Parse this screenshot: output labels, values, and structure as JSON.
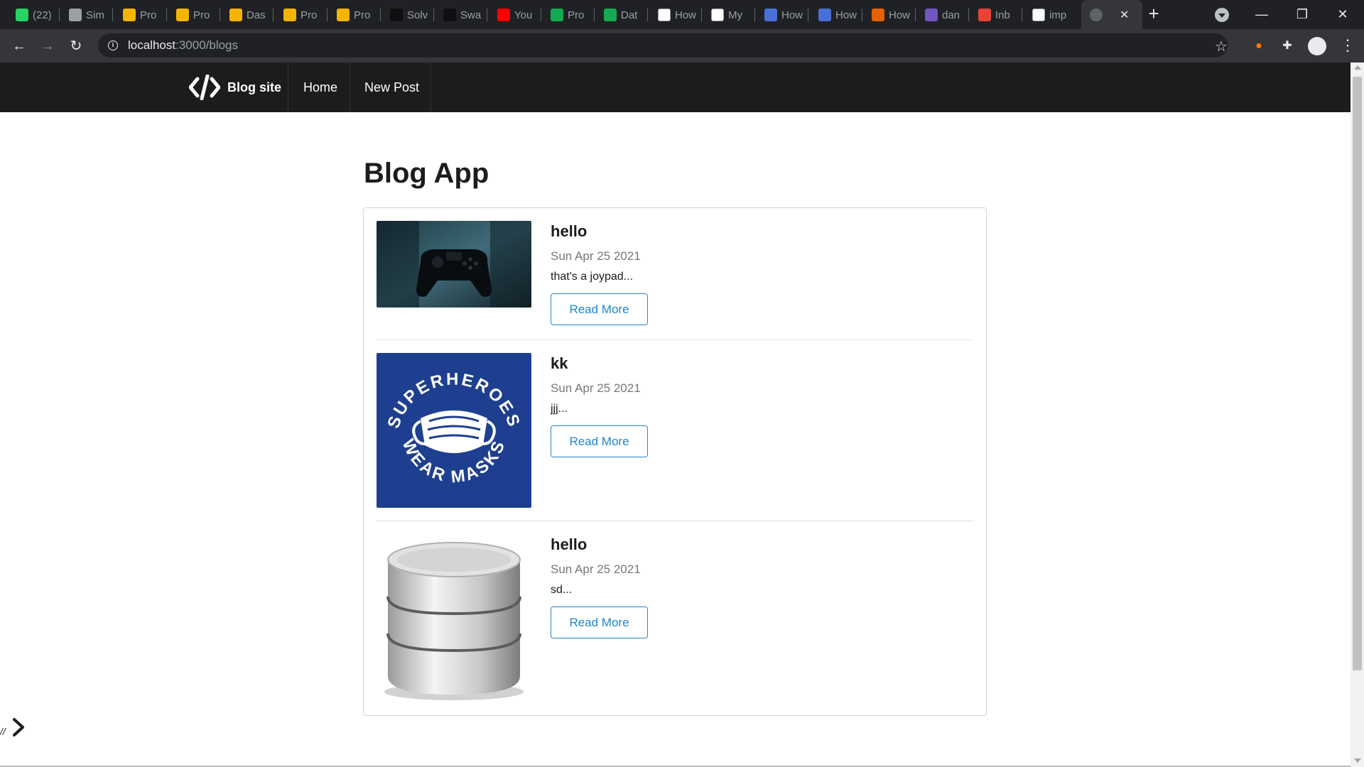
{
  "browser": {
    "tabs": [
      {
        "label": "(22)",
        "favicon": "whatsapp-icon",
        "color": "#25d366"
      },
      {
        "label": "Sim",
        "favicon": "runner-icon",
        "color": "#9aa0a6"
      },
      {
        "label": "Pro",
        "favicon": "chart-icon",
        "color": "#f4b400"
      },
      {
        "label": "Pro",
        "favicon": "chart-icon",
        "color": "#f4b400"
      },
      {
        "label": "Das",
        "favicon": "chart-icon",
        "color": "#f4b400"
      },
      {
        "label": "Pro",
        "favicon": "chart-icon",
        "color": "#f4b400"
      },
      {
        "label": "Pro",
        "favicon": "chart-icon",
        "color": "#f4b400"
      },
      {
        "label": "Solv",
        "favicon": "hackerrank-icon",
        "color": "#0f0f0f"
      },
      {
        "label": "Swa",
        "favicon": "hackerrank-icon",
        "color": "#0f0f0f"
      },
      {
        "label": "You",
        "favicon": "youtube-icon",
        "color": "#ff0000"
      },
      {
        "label": "Pro",
        "favicon": "mongodb-leaf-icon",
        "color": "#13aa52"
      },
      {
        "label": "Dat",
        "favicon": "mongodb-leaf-icon",
        "color": "#13aa52"
      },
      {
        "label": "How",
        "favicon": "geeks-icon",
        "color": "#ffffff"
      },
      {
        "label": "My",
        "favicon": "geeks-icon",
        "color": "#ffffff"
      },
      {
        "label": "How",
        "favicon": "shield-icon",
        "color": "#4a6fd8"
      },
      {
        "label": "How",
        "favicon": "shield-icon",
        "color": "#4a6fd8"
      },
      {
        "label": "How",
        "favicon": "firefox-icon",
        "color": "#e66000"
      },
      {
        "label": "dan",
        "favicon": "heroku-icon",
        "color": "#7056bf"
      },
      {
        "label": "Inb",
        "favicon": "gmail-icon",
        "color": "#ea4335"
      },
      {
        "label": "imp",
        "favicon": "github-icon",
        "color": "#ffffff"
      }
    ],
    "active_tab_favicon": "globe-icon",
    "url_host": "localhost",
    "url_rest": ":3000/blogs"
  },
  "site": {
    "brand": "Blog site",
    "nav": {
      "home": "Home",
      "new_post": "New Post"
    },
    "page_title": "Blog App",
    "accent_color": "#2185d0",
    "navbar_color": "#1b1c1d",
    "read_more_label": "Read More",
    "posts": [
      {
        "title": "hello",
        "date": "Sun Apr 25 2021",
        "excerpt": "that's a joypad...",
        "image": "game-controller-image"
      },
      {
        "title": "kk",
        "date": "Sun Apr 25 2021",
        "excerpt": "jjj...",
        "image": "superheroes-wear-masks-image",
        "image_text_top": "SUPERHEROES",
        "image_text_bottom": "WEAR MASKS"
      },
      {
        "title": "hello",
        "date": "Sun Apr 25 2021",
        "excerpt": "sd...",
        "image": "database-cylinder-image"
      }
    ],
    "dev_toggle_text": "//"
  }
}
